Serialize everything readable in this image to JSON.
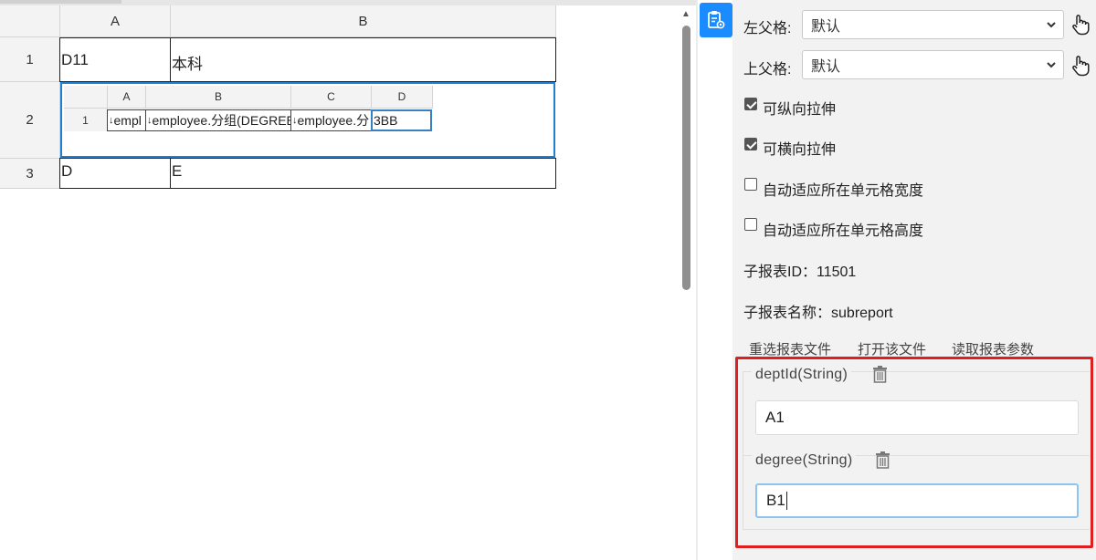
{
  "sheet": {
    "columns": [
      "A",
      "B"
    ],
    "rows": [
      "1",
      "2",
      "3"
    ],
    "cells": {
      "a1": "D11",
      "b1": "本科",
      "a3": "D",
      "b3": "E"
    },
    "subreport_preview": {
      "columns": [
        "A",
        "B",
        "C",
        "D"
      ],
      "row": "1",
      "cells": [
        "empl",
        "employee.分组(DEGREE)",
        "employee.分",
        "3BB"
      ]
    }
  },
  "panel": {
    "left_parent_label": "左父格:",
    "left_parent_value": "默认",
    "top_parent_label": "上父格:",
    "top_parent_value": "默认",
    "vertical_stretch": {
      "label": "可纵向拉伸",
      "checked": true
    },
    "horizontal_stretch": {
      "label": "可横向拉伸",
      "checked": true
    },
    "auto_fit_width": {
      "label": "自动适应所在单元格宽度",
      "checked": false
    },
    "auto_fit_height": {
      "label": "自动适应所在单元格高度",
      "checked": false
    },
    "subreport_id_label": "子报表ID：",
    "subreport_id": "11501",
    "subreport_name_label": "子报表名称：",
    "subreport_name": "subreport",
    "actions": [
      "重选报表文件",
      "打开该文件",
      "读取报表参数"
    ],
    "params": [
      {
        "name": "deptId(String)",
        "value": "A1"
      },
      {
        "name": "degree(String)",
        "value": "B1"
      }
    ]
  },
  "colors": {
    "accent": "#1a8cff",
    "highlight_border": "#e02020",
    "subreport_border": "#1f7fd0"
  },
  "icons": {
    "settings": "report-settings-icon",
    "hand": "hand-pointer-icon",
    "trash": "trash-icon"
  }
}
